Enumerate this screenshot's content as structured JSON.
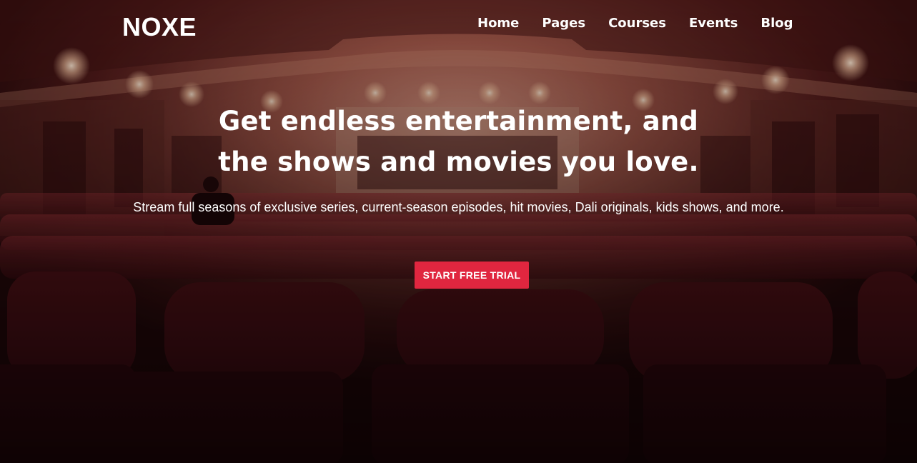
{
  "brand": {
    "logo_text": "NOXE"
  },
  "nav": {
    "items": [
      {
        "label": "Home"
      },
      {
        "label": "Pages"
      },
      {
        "label": "Courses"
      },
      {
        "label": "Events"
      },
      {
        "label": "Blog"
      }
    ]
  },
  "hero": {
    "headline_line1": "Get endless entertainment, and",
    "headline_line2": "the shows and movies you love.",
    "subtitle": "Stream full seasons of exclusive series, current-season episodes, hit movies, Dali originals, kids shows, and more.",
    "cta_label": "START FREE TRIAL",
    "background": "theater-auditorium-photo"
  },
  "colors": {
    "accent": "#e0263f",
    "overlay": "#5a1a1a",
    "text": "#ffffff"
  }
}
